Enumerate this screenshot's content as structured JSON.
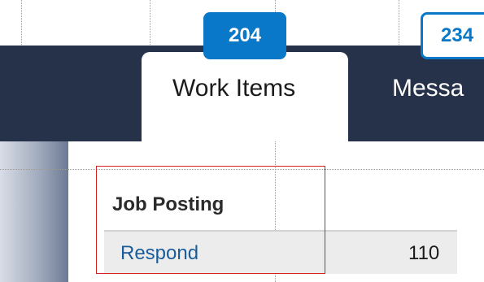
{
  "tabs": {
    "work_items": {
      "label": "Work Items",
      "badge": "204"
    },
    "messages": {
      "label": "Messa",
      "badge": "234"
    }
  },
  "section": {
    "title": "Job Posting",
    "rows": [
      {
        "label": "Respond",
        "count": "110"
      }
    ]
  },
  "colors": {
    "nav_bg": "#25324a",
    "badge_blue": "#0a78c8",
    "link_blue": "#1a5c9a",
    "highlight_red": "#d22020"
  }
}
